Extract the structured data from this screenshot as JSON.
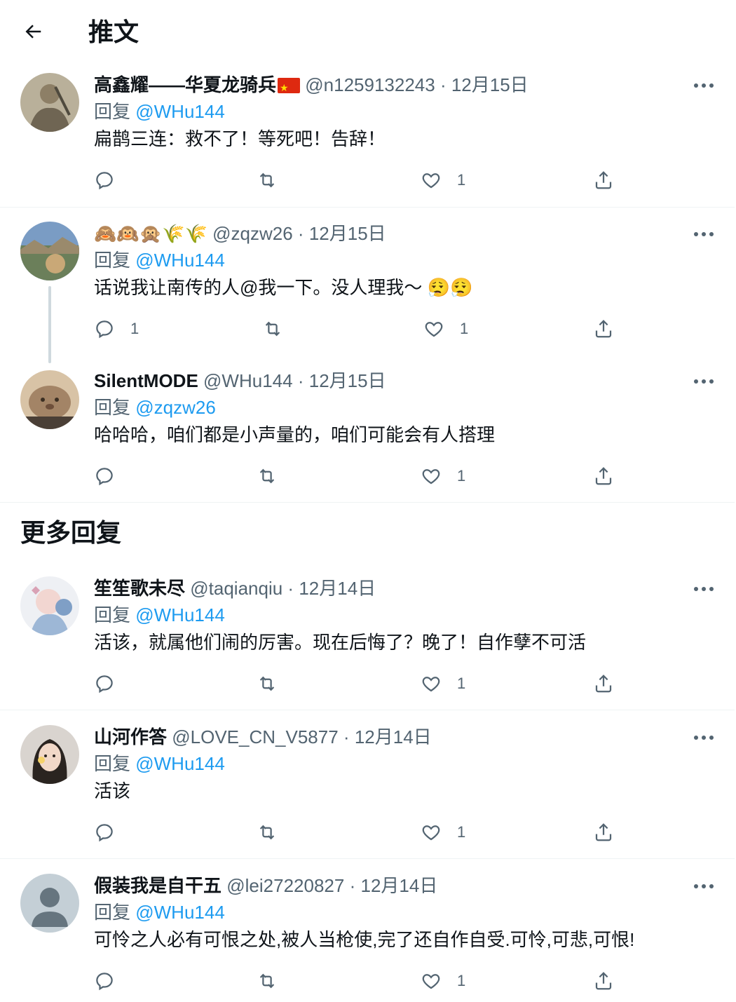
{
  "header": {
    "title": "推文"
  },
  "section": {
    "more_replies": "更多回复"
  },
  "tweets": [
    {
      "name": "高鑫耀——华夏龙骑兵",
      "handle": "@n1259132243",
      "sep": "·",
      "date": "12月15日",
      "reply_prefix": "回复",
      "reply_to": "@WHu144",
      "text": "扁鹊三连：救不了！等死吧！告辞！",
      "replies": "",
      "likes": "1"
    },
    {
      "name": "🙈🙉🙊🌾🌾",
      "handle": "@zqzw26",
      "sep": "·",
      "date": "12月15日",
      "reply_prefix": "回复",
      "reply_to": "@WHu144",
      "text": "话说我让南传的人@我一下。没人理我～ 😮‍💨😮‍💨",
      "replies": "1",
      "likes": "1"
    },
    {
      "name": "SilentMODE",
      "handle": "@WHu144",
      "sep": "·",
      "date": "12月15日",
      "reply_prefix": "回复",
      "reply_to": "@zqzw26",
      "text": "哈哈哈，咱们都是小声量的，咱们可能会有人搭理",
      "replies": "",
      "likes": "1"
    },
    {
      "name": "笙笙歌未尽",
      "handle": "@taqianqiu",
      "sep": "·",
      "date": "12月14日",
      "reply_prefix": "回复",
      "reply_to": "@WHu144",
      "text": "活该，就属他们闹的厉害。现在后悔了？晚了！自作孽不可活",
      "replies": "",
      "likes": "1"
    },
    {
      "name": "山河作答",
      "handle": "@LOVE_CN_V5877",
      "sep": "·",
      "date": "12月14日",
      "reply_prefix": "回复",
      "reply_to": "@WHu144",
      "text": "活该",
      "replies": "",
      "likes": "1"
    },
    {
      "name": "假装我是自干五",
      "handle": "@lei27220827",
      "sep": "·",
      "date": "12月14日",
      "reply_prefix": "回复",
      "reply_to": "@WHu144",
      "text": "可怜之人必有可恨之处,被人当枪使,完了还自作自受.可怜,可悲,可恨!",
      "replies": "",
      "likes": "1"
    }
  ],
  "colors": {
    "accent": "#1d9bf0",
    "secondary_text": "#536471",
    "divider": "#eff3f4",
    "flag": "#de2910"
  },
  "icons": [
    "back-arrow-icon",
    "more-icon",
    "reply-icon",
    "retweet-icon",
    "like-icon",
    "share-icon",
    "china-flag-icon",
    "default-avatar-icon"
  ]
}
